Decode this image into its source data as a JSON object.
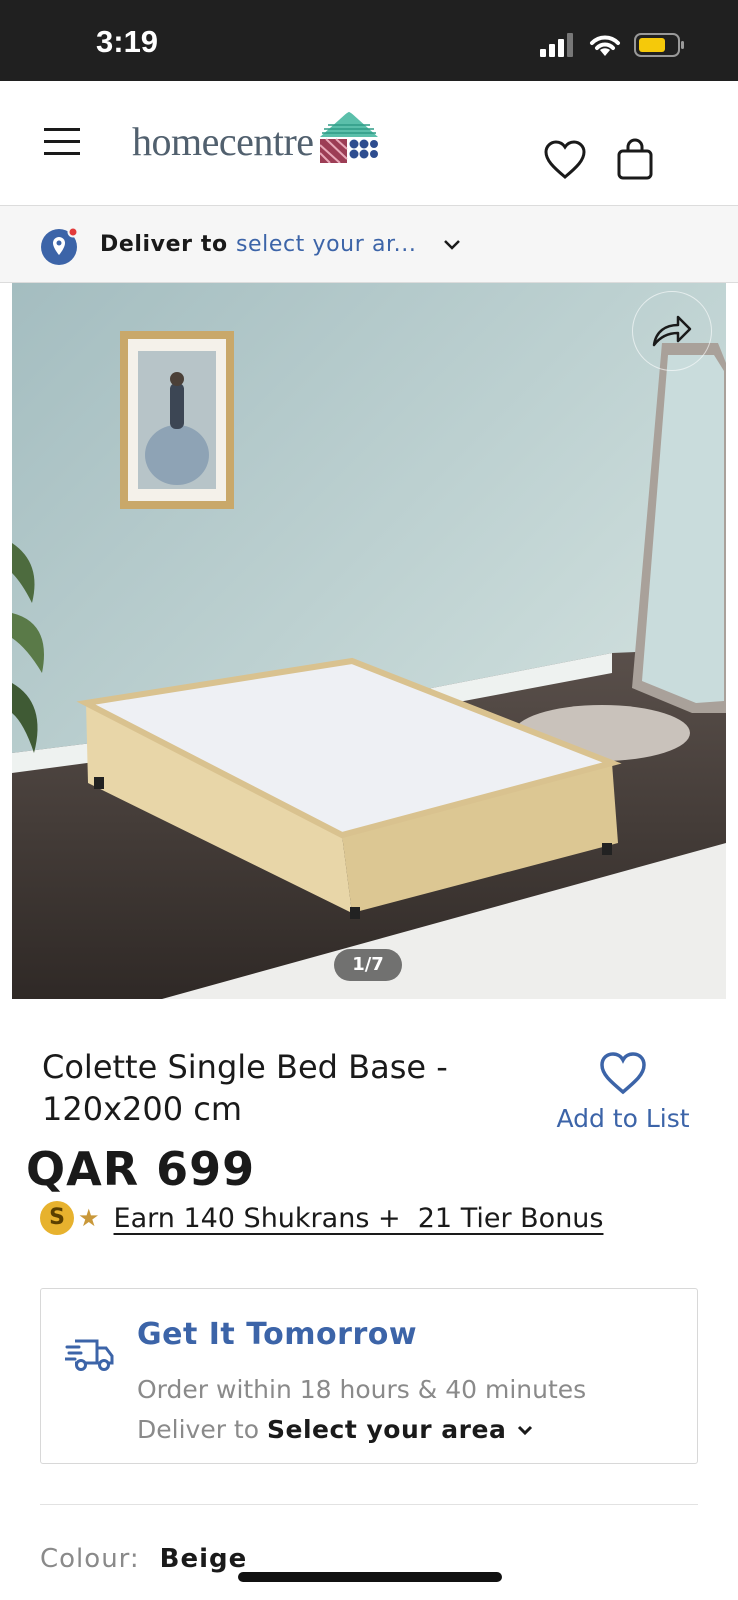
{
  "status_bar": {
    "time": "3:19"
  },
  "header": {
    "logo_text": "homecentre"
  },
  "deliver_bar": {
    "prefix": "Deliver to",
    "area": "select your ar..."
  },
  "gallery": {
    "counter": "1/7"
  },
  "product": {
    "title": "Colette Single Bed Base - 120x200 cm",
    "add_to_list": "Add to List",
    "price": "QAR 699",
    "shukran_badge": "S",
    "shukran_text": "Earn 140 Shukrans +  21 Tier Bonus"
  },
  "delivery": {
    "heading": "Get It Tomorrow",
    "order_within": "Order within 18 hours & 40 minutes",
    "deliver_prefix": "Deliver to",
    "area": "Select your area"
  },
  "colour": {
    "label": "Colour:",
    "value": "Beige"
  },
  "colors": {
    "brand_blue": "#3c64a8",
    "price": "#1a1a1a",
    "shukran_gold": "#e7b22e",
    "status_bar": "#202020"
  },
  "icons": [
    "menu-icon",
    "wishlist-heart-icon",
    "shopping-bag-icon",
    "location-pin-icon",
    "chevron-down-icon",
    "share-icon",
    "heart-icon",
    "delivery-truck-icon"
  ]
}
